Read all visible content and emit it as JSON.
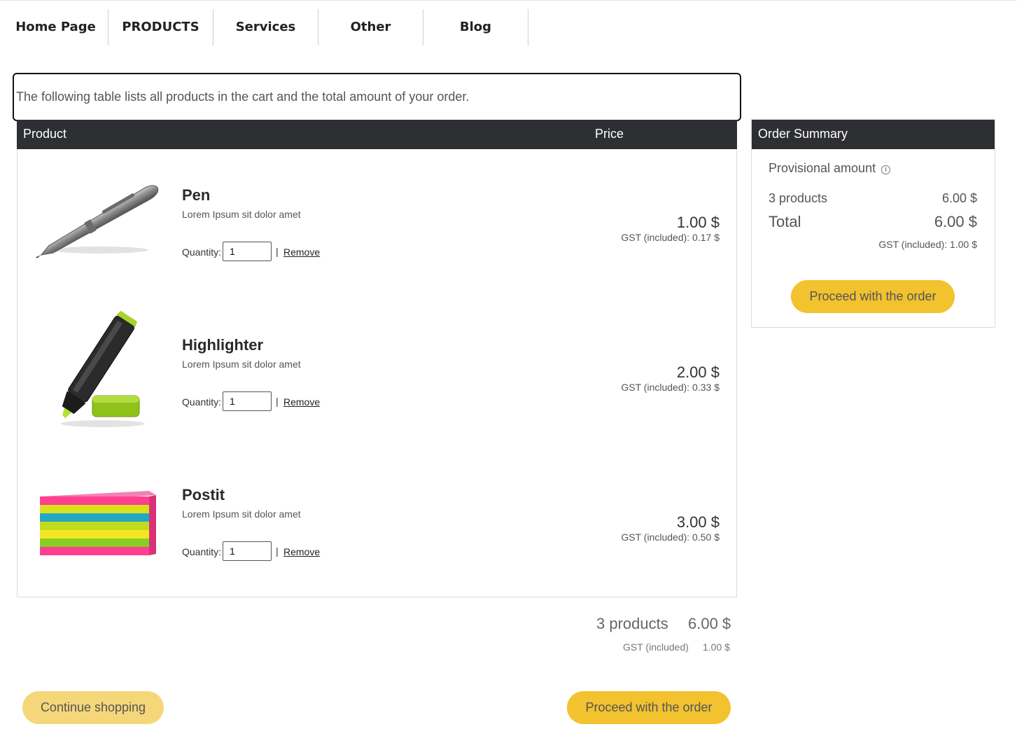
{
  "nav": {
    "items": [
      {
        "label": "Home Page"
      },
      {
        "label": "PRODUCTS"
      },
      {
        "label": "Services"
      },
      {
        "label": "Other"
      },
      {
        "label": "Blog"
      }
    ]
  },
  "caption": "The following table lists all products in the cart and the total amount of your order.",
  "table": {
    "col_product": "Product",
    "col_price": "Price"
  },
  "items": [
    {
      "name": "Pen",
      "description": "Lorem Ipsum sit dolor amet",
      "quantity_label": "Quantity:",
      "quantity": "1",
      "separator": "|",
      "remove_label": "Remove",
      "price": "1.00 $",
      "gst": "GST (included): 0.17 $",
      "icon": "pen-image"
    },
    {
      "name": "Highlighter",
      "description": "Lorem Ipsum sit dolor amet",
      "quantity_label": "Quantity:",
      "quantity": "1",
      "separator": "|",
      "remove_label": "Remove",
      "price": "2.00 $",
      "gst": "GST (included): 0.33 $",
      "icon": "highlighter-image"
    },
    {
      "name": "Postit",
      "description": "Lorem Ipsum sit dolor amet",
      "quantity_label": "Quantity:",
      "quantity": "1",
      "separator": "|",
      "remove_label": "Remove",
      "price": "3.00 $",
      "gst": "GST (included): 0.50 $",
      "icon": "postit-image"
    }
  ],
  "totals": {
    "count": "3 products",
    "amount": "6.00 $",
    "gst_label": "GST (included)",
    "gst_value": "1.00 $"
  },
  "buttons": {
    "continue": "Continue shopping",
    "proceed": "Proceed with the order"
  },
  "summary": {
    "title": "Order Summary",
    "provisional_label": "Provisional amount",
    "info_icon_glyph": "i",
    "count": "3 products",
    "count_value": "6.00 $",
    "total_label": "Total",
    "total_value": "6.00 $",
    "gst": "GST (included): 1.00 $",
    "proceed": "Proceed with the order"
  },
  "colors": {
    "header_dark": "#2e2f33",
    "button_yellow": "#f2c22f",
    "button_yellow_light": "#f5d77a"
  }
}
